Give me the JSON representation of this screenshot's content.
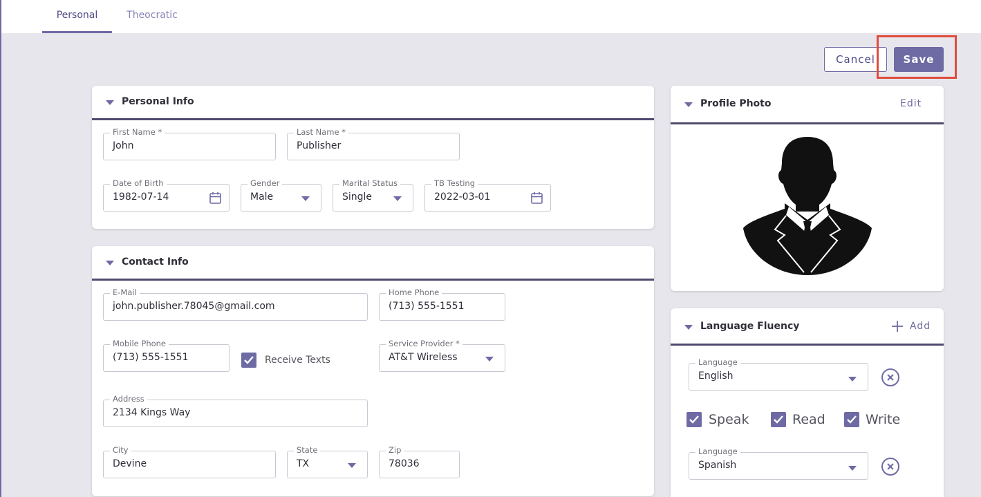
{
  "tabs": [
    {
      "label": "Personal",
      "active": true
    },
    {
      "label": "Theocratic",
      "active": false
    }
  ],
  "actions": {
    "cancel_label": "Cancel",
    "save_label": "Save"
  },
  "personal_info": {
    "title": "Personal Info",
    "first_name": {
      "label": "First Name *",
      "value": "John"
    },
    "last_name": {
      "label": "Last Name *",
      "value": "Publisher"
    },
    "date_of_birth": {
      "label": "Date of Birth",
      "value": "1982-07-14",
      "icon": "calendar-icon"
    },
    "gender": {
      "label": "Gender",
      "value": "Male"
    },
    "marital_status": {
      "label": "Marital Status",
      "value": "Single"
    },
    "tb_testing": {
      "label": "TB Testing",
      "value": "2022-03-01",
      "icon": "calendar-icon"
    }
  },
  "contact_info": {
    "title": "Contact Info",
    "email": {
      "label": "E-Mail",
      "value": "john.publisher.78045@gmail.com"
    },
    "home_phone": {
      "label": "Home Phone",
      "value": "(713) 555-1551"
    },
    "mobile_phone": {
      "label": "Mobile Phone",
      "value": "(713) 555-1551"
    },
    "receive_texts": {
      "label": "Receive Texts",
      "checked": true
    },
    "service_provider": {
      "label": "Service Provider *",
      "value": "AT&T Wireless"
    },
    "address": {
      "label": "Address",
      "value": "2134 Kings Way"
    },
    "city": {
      "label": "City",
      "value": "Devine"
    },
    "state": {
      "label": "State",
      "value": "TX"
    },
    "zip": {
      "label": "Zip",
      "value": "78036"
    }
  },
  "profile_photo": {
    "title": "Profile Photo",
    "edit_label": "Edit",
    "image": "person-silhouette-icon"
  },
  "language_fluency": {
    "title": "Language Fluency",
    "add_label": "Add",
    "languages": [
      {
        "label": "Language",
        "value": "English",
        "speak": "Speak",
        "read": "Read",
        "write": "Write",
        "speak_checked": true,
        "read_checked": true,
        "write_checked": true
      },
      {
        "label": "Language",
        "value": "Spanish"
      }
    ]
  },
  "colors": {
    "accent": "#6e6aa4",
    "highlight": "#e14b3b",
    "background": "#e7e6ec"
  }
}
